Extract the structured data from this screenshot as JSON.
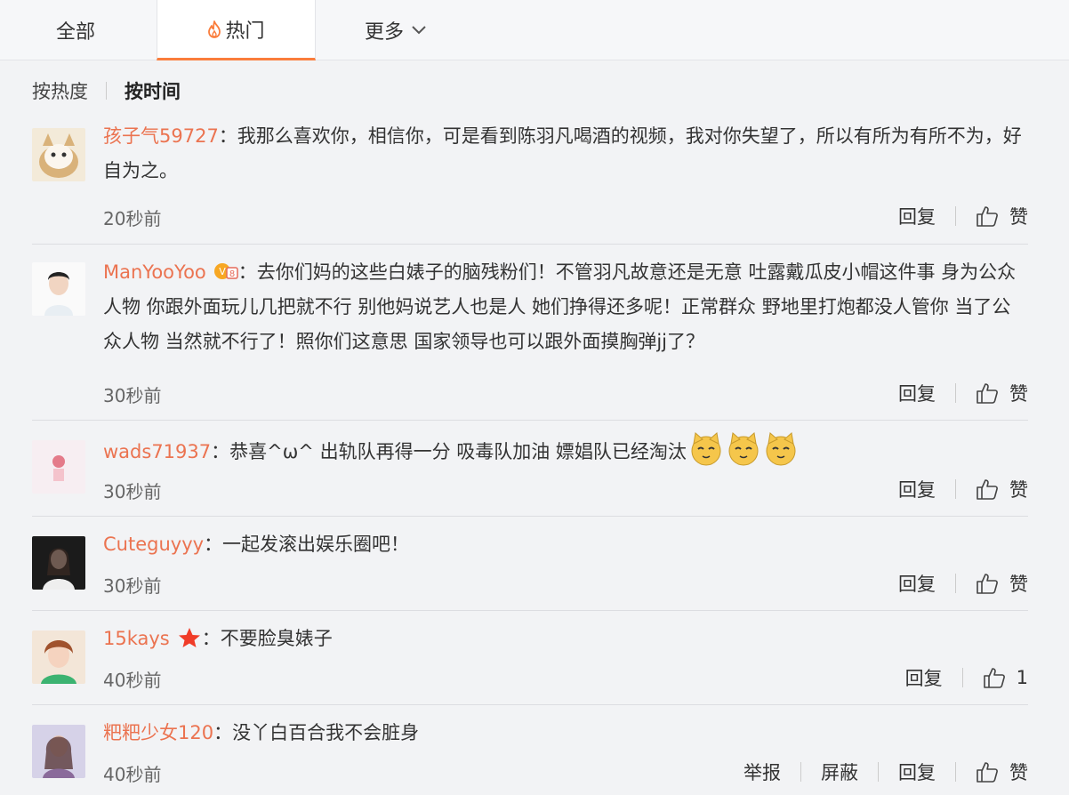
{
  "tabs": {
    "all": "全部",
    "hot": "热门",
    "more": "更多"
  },
  "sort": {
    "heat": "按热度",
    "time": "按时间"
  },
  "actions": {
    "reply": "回复",
    "like": "赞",
    "report": "举报",
    "block": "屏蔽"
  },
  "comments": [
    {
      "user": "孩子气59727",
      "text": "：我那么喜欢你，相信你，可是看到陈羽凡喝酒的视频，我对你失望了，所以有所为有所不为，好自为之。",
      "time": "20秒前"
    },
    {
      "user": "ManYooYoo",
      "text": "：去你们妈的这些白婊子的脑残粉们！不管羽凡故意还是无意 吐露戴瓜皮小帽这件事 身为公众人物 你跟外面玩儿几把就不行 别他妈说艺人也是人 她们挣得还多呢！正常群众 野地里打炮都没人管你 当了公众人物 当然就不行了！照你们这意思 国家领导也可以跟外面摸胸弹jj了？",
      "time": "30秒前"
    },
    {
      "user": "wads71937",
      "text": "：恭喜^ω^  出轨队再得一分  吸毒队加油 嫖娼队已经淘汰",
      "time": "30秒前"
    },
    {
      "user": "Cuteguyyy",
      "text": "：一起发滚出娱乐圈吧！",
      "time": "30秒前"
    },
    {
      "user": "15kays",
      "text": "：不要脸臭婊子",
      "time": "40秒前",
      "likes": "1"
    },
    {
      "user": "粑粑少女120",
      "text": "：没丫白百合我不会脏身",
      "time": "40秒前"
    }
  ],
  "colors": {
    "accent": "#fa7d3c",
    "username": "#eb7350"
  },
  "icons": [
    "flame-icon",
    "chevron-down-icon",
    "thumbs-up-icon",
    "vip-badge-icon",
    "star-badge-icon",
    "cat-emoji-icon"
  ]
}
